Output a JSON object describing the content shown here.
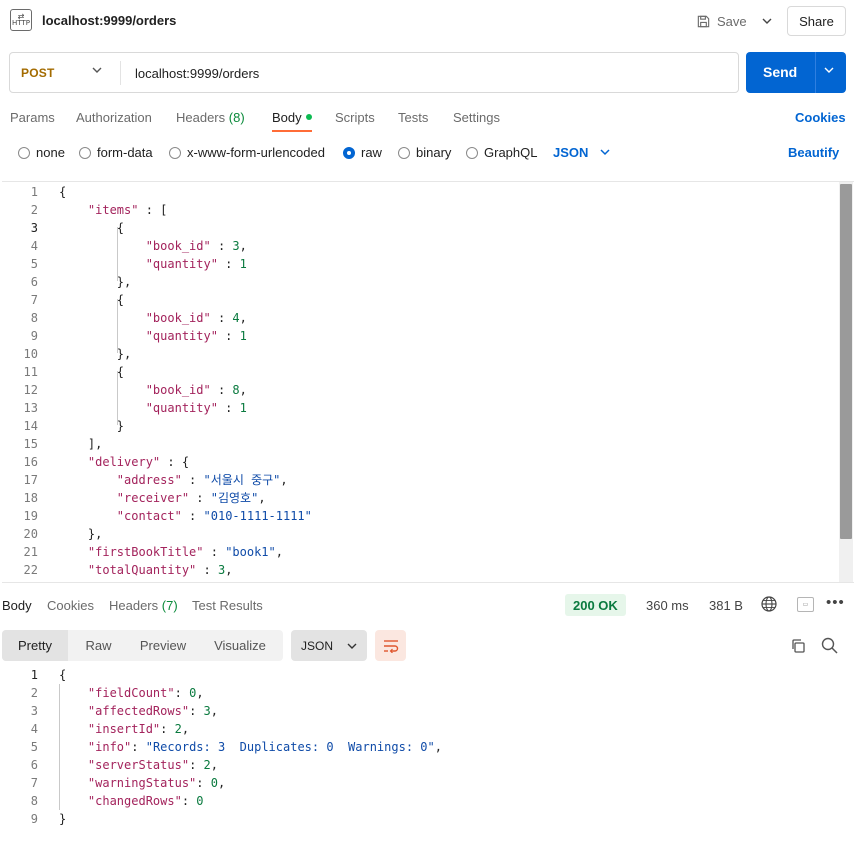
{
  "tab": {
    "title": "localhost:9999/orders",
    "icon": "http-file-icon",
    "icon_label": "HTTP"
  },
  "toolbar": {
    "save_label": "Save",
    "share_label": "Share"
  },
  "request": {
    "method": "POST",
    "url": "localhost:9999/orders",
    "send_label": "Send"
  },
  "req_tabs": {
    "params": "Params",
    "authorization": "Authorization",
    "headers": "Headers",
    "headers_count": "(8)",
    "body": "Body",
    "scripts": "Scripts",
    "tests": "Tests",
    "settings": "Settings",
    "cookies": "Cookies"
  },
  "body_types": {
    "none": "none",
    "form_data": "form-data",
    "urlencoded": "x-www-form-urlencoded",
    "raw": "raw",
    "binary": "binary",
    "graphql": "GraphQL",
    "selected": "raw",
    "format": "JSON",
    "beautify": "Beautify"
  },
  "request_body_lines": [
    "{",
    "    \"items\" : [",
    "        {",
    "            \"book_id\" : 3,",
    "            \"quantity\" : 1",
    "        },",
    "        {",
    "            \"book_id\" : 4,",
    "            \"quantity\" : 1",
    "        },",
    "        {",
    "            \"book_id\" : 8,",
    "            \"quantity\" : 1",
    "        }",
    "    ],",
    "    \"delivery\" : {",
    "        \"address\" : \"서울시 중구\",",
    "        \"receiver\" : \"김영호\",",
    "        \"contact\" : \"010-1111-1111\"",
    "    },",
    "    \"firstBookTitle\" : \"book1\",",
    "    \"totalQuantity\" : 3,"
  ],
  "response": {
    "tabs": {
      "body": "Body",
      "cookies": "Cookies",
      "headers": "Headers",
      "headers_count": "(7)",
      "test_results": "Test Results"
    },
    "status": "200 OK",
    "time": "360 ms",
    "size": "381 B",
    "views": {
      "pretty": "Pretty",
      "raw": "Raw",
      "preview": "Preview",
      "visualize": "Visualize"
    },
    "format": "JSON",
    "body_lines": [
      "{",
      "    \"fieldCount\": 0,",
      "    \"affectedRows\": 3,",
      "    \"insertId\": 2,",
      "    \"info\": \"Records: 3  Duplicates: 0  Warnings: 0\",",
      "    \"serverStatus\": 2,",
      "    \"warningStatus\": 0,",
      "    \"changedRows\": 0",
      "}"
    ]
  },
  "colors": {
    "accent": "#0265d2",
    "method": "#a36b00",
    "status": "#0a7a3f",
    "tab_underline": "#ff6c37"
  }
}
